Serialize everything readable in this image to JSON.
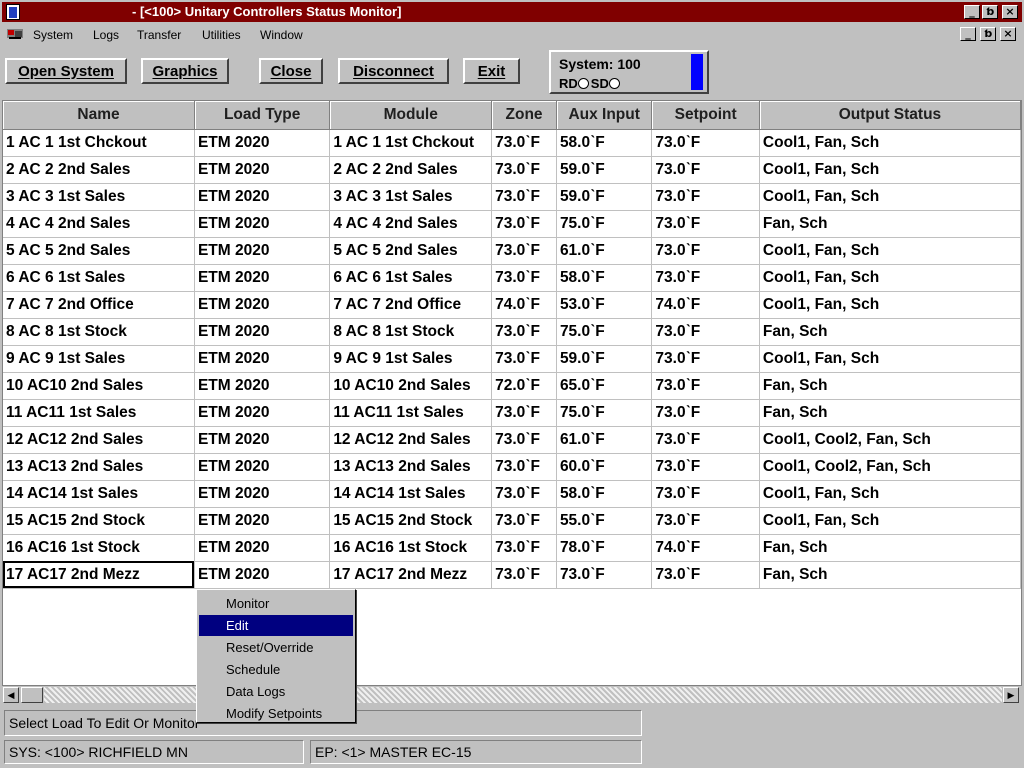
{
  "window": {
    "title": "- [<100> Unitary Controllers Status Monitor]",
    "minimize": "_",
    "restore": "ƅ",
    "close": "×"
  },
  "menubar": {
    "items": [
      "System",
      "Logs",
      "Transfer",
      "Utilities",
      "Window"
    ],
    "min": "_",
    "restore": "ƅ",
    "close": "×"
  },
  "toolbar": {
    "open_system": "Open System",
    "graphics": "Graphics",
    "close": "Close",
    "disconnect": "Disconnect",
    "exit": "Exit"
  },
  "system_box": {
    "label": "System: 100",
    "rd": "RD",
    "sd": "SD",
    "indicator_color": "#0000ff"
  },
  "table": {
    "headers": [
      "Name",
      "Load Type",
      "Module",
      "Zone",
      "Aux Input",
      "Setpoint",
      "Output Status"
    ],
    "rows": [
      [
        "1 AC 1 1st Chckout",
        "ETM 2020",
        "1 AC 1 1st Chckout",
        "73.0ˋF",
        "58.0ˋF",
        "73.0ˋF",
        "Cool1, Fan, Sch"
      ],
      [
        "2 AC 2 2nd Sales",
        "ETM 2020",
        "2 AC 2 2nd Sales",
        "73.0ˋF",
        "59.0ˋF",
        "73.0ˋF",
        "Cool1, Fan, Sch"
      ],
      [
        "3 AC 3 1st Sales",
        "ETM 2020",
        "3 AC 3 1st Sales",
        "73.0ˋF",
        "59.0ˋF",
        "73.0ˋF",
        "Cool1, Fan, Sch"
      ],
      [
        "4 AC 4 2nd Sales",
        "ETM 2020",
        "4 AC 4 2nd Sales",
        "73.0ˋF",
        "75.0ˋF",
        "73.0ˋF",
        "Fan, Sch"
      ],
      [
        "5 AC 5 2nd Sales",
        "ETM 2020",
        "5 AC 5 2nd Sales",
        "73.0ˋF",
        "61.0ˋF",
        "73.0ˋF",
        "Cool1, Fan, Sch"
      ],
      [
        "6 AC 6 1st Sales",
        "ETM 2020",
        "6 AC 6 1st Sales",
        "73.0ˋF",
        "58.0ˋF",
        "73.0ˋF",
        "Cool1, Fan, Sch"
      ],
      [
        "7 AC 7 2nd Office",
        "ETM 2020",
        "7 AC 7 2nd Office",
        "74.0ˋF",
        "53.0ˋF",
        "74.0ˋF",
        "Cool1, Fan, Sch"
      ],
      [
        "8 AC 8 1st Stock",
        "ETM 2020",
        "8 AC 8 1st Stock",
        "73.0ˋF",
        "75.0ˋF",
        "73.0ˋF",
        "Fan, Sch"
      ],
      [
        "9 AC 9 1st Sales",
        "ETM 2020",
        "9 AC 9 1st Sales",
        "73.0ˋF",
        "59.0ˋF",
        "73.0ˋF",
        "Cool1, Fan, Sch"
      ],
      [
        "10 AC10 2nd Sales",
        "ETM 2020",
        "10 AC10 2nd Sales",
        "72.0ˋF",
        "65.0ˋF",
        "73.0ˋF",
        "Fan, Sch"
      ],
      [
        "11 AC11 1st Sales",
        "ETM 2020",
        "11 AC11 1st Sales",
        "73.0ˋF",
        "75.0ˋF",
        "73.0ˋF",
        "Fan, Sch"
      ],
      [
        "12 AC12 2nd Sales",
        "ETM 2020",
        "12 AC12 2nd Sales",
        "73.0ˋF",
        "61.0ˋF",
        "73.0ˋF",
        "Cool1, Cool2, Fan, Sch"
      ],
      [
        "13 AC13 2nd Sales",
        "ETM 2020",
        "13 AC13 2nd Sales",
        "73.0ˋF",
        "60.0ˋF",
        "73.0ˋF",
        "Cool1, Cool2, Fan, Sch"
      ],
      [
        "14 AC14 1st Sales",
        "ETM 2020",
        "14 AC14 1st Sales",
        "73.0ˋF",
        "58.0ˋF",
        "73.0ˋF",
        "Cool1, Fan, Sch"
      ],
      [
        "15 AC15 2nd Stock",
        "ETM 2020",
        "15 AC15 2nd Stock",
        "73.0ˋF",
        "55.0ˋF",
        "73.0ˋF",
        "Cool1, Fan, Sch"
      ],
      [
        "16 AC16 1st Stock",
        "ETM 2020",
        "16 AC16 1st Stock",
        "73.0ˋF",
        "78.0ˋF",
        "74.0ˋF",
        "Fan, Sch"
      ],
      [
        "17 AC17 2nd Mezz",
        "ETM 2020",
        "17 AC17 2nd Mezz",
        "73.0ˋF",
        "73.0ˋF",
        "73.0ˋF",
        "Fan, Sch"
      ]
    ],
    "selected_row": 16
  },
  "context_menu": {
    "items": [
      "Monitor",
      "Edit",
      "Reset/Override",
      "Schedule",
      "Data Logs",
      "Modify Setpoints"
    ],
    "highlighted": 1
  },
  "status": {
    "message": "Select Load To Edit Or Monitor",
    "system": "SYS: <100> RICHFIELD MN",
    "ep": "EP: <1> MASTER EC-15"
  },
  "colors": {
    "title_bar": "#800000",
    "face": "#c0c0c0",
    "highlight": "#000080"
  },
  "icons": [
    "app-icon",
    "system-menu-icon",
    "minimize-icon",
    "restore-icon",
    "close-icon",
    "scroll-left-icon",
    "scroll-right-icon"
  ]
}
